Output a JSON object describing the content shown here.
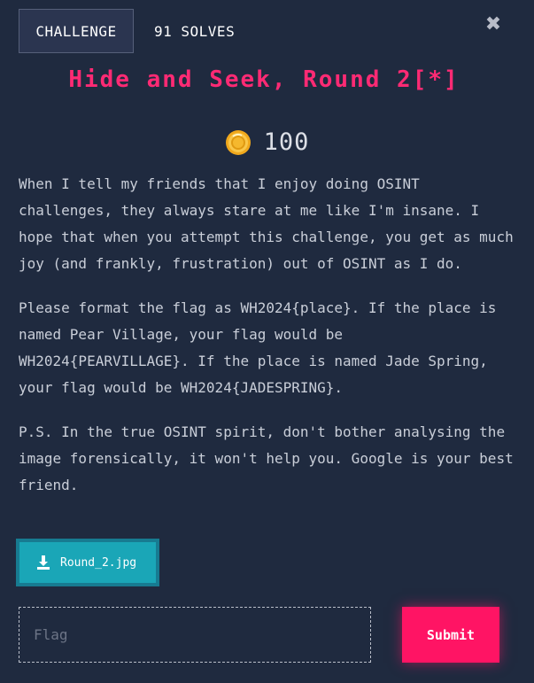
{
  "header": {
    "tab_challenge": "CHALLENGE",
    "tab_solves": "91 SOLVES",
    "close_symbol": "✖"
  },
  "challenge": {
    "title": "Hide and Seek, Round 2[*]",
    "points": "100",
    "description": [
      "When I tell my friends that I enjoy doing OSINT challenges, they always stare at me like I'm insane. I hope that when you attempt this challenge, you get as much joy (and frankly, frustration) out of OSINT as I do.",
      "Please format the flag as WH2024{place}. If the place is named Pear Village, your flag would be WH2024{PEARVILLAGE}. If the place is named Jade Spring, your flag would be WH2024{JADESPRING}.",
      "P.S. In the true OSINT spirit, don't bother analysing the image forensically, it won't help you. Google is your best friend."
    ],
    "attachment_label": "Round_2.jpg"
  },
  "form": {
    "flag_placeholder": "Flag",
    "flag_value": "",
    "submit_label": "Submit"
  },
  "icons": {
    "close": "close-icon",
    "coin": "coin-icon",
    "download": "download-icon"
  },
  "colors": {
    "background": "#1f2a3f",
    "title": "#ff2a74",
    "submit": "#ff1464",
    "download": "#1aa6b7",
    "coin": "#f5b82e"
  }
}
